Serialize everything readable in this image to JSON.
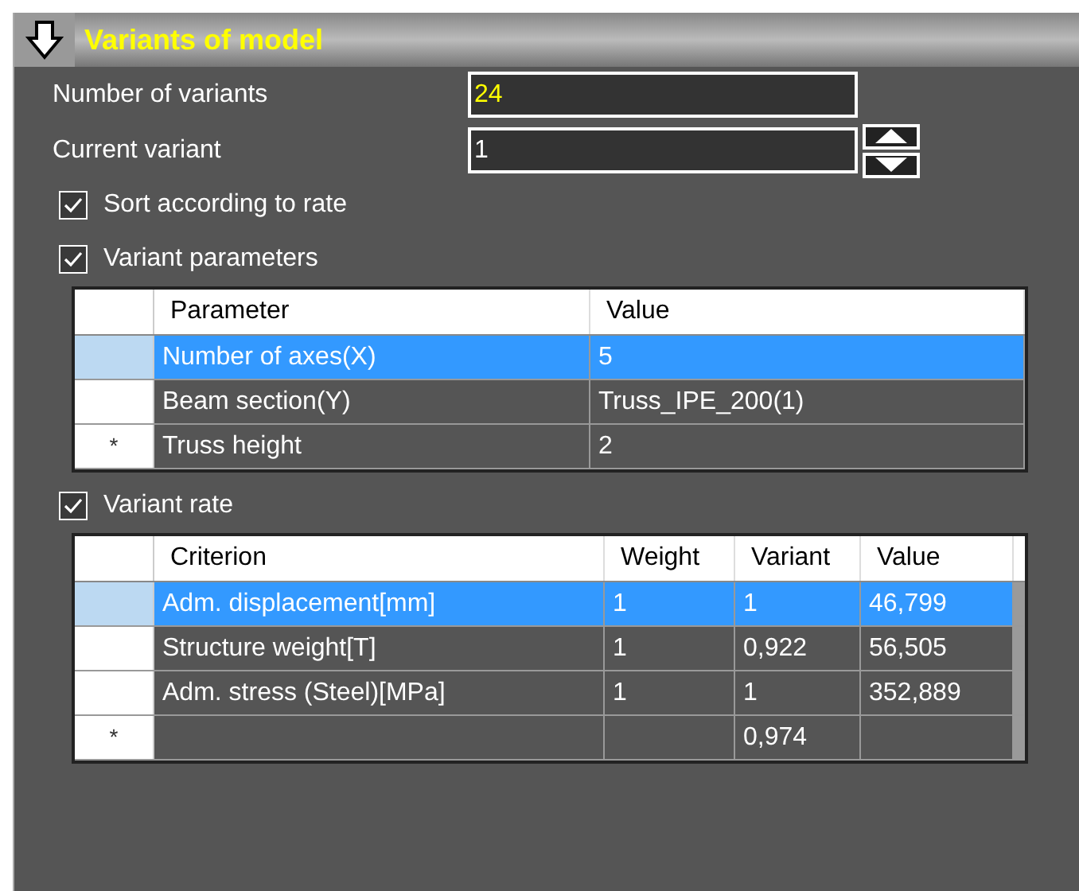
{
  "header": {
    "title": "Variants of model",
    "expanded": true
  },
  "fields": [
    {
      "label": "Number of variants",
      "value": "24",
      "kind": "readonly"
    },
    {
      "label": "Current variant",
      "value": "1",
      "kind": "spinner"
    }
  ],
  "sort_option": {
    "label": "Sort according to rate",
    "checked": true
  },
  "parameters": {
    "label": "Variant parameters",
    "checked": true,
    "columns": [
      "Parameter",
      "Value"
    ],
    "rows": [
      {
        "marker": "",
        "selected": true,
        "cells": [
          "Number of axes(X)",
          "5"
        ]
      },
      {
        "marker": "",
        "selected": false,
        "cells": [
          "Beam section(Y)",
          "Truss_IPE_200(1)"
        ]
      },
      {
        "marker": "*",
        "selected": false,
        "cells": [
          "Truss height",
          "2"
        ]
      }
    ]
  },
  "rate": {
    "label": "Variant rate",
    "checked": true,
    "columns": [
      "Criterion",
      "Weight",
      "Variant",
      "Value"
    ],
    "rows": [
      {
        "marker": "",
        "selected": true,
        "cells": [
          "Adm. displacement[mm]",
          "1",
          "1",
          "46,799"
        ]
      },
      {
        "marker": "",
        "selected": false,
        "cells": [
          "Structure weight[T]",
          "1",
          "0,922",
          "56,505"
        ]
      },
      {
        "marker": "",
        "selected": false,
        "cells": [
          "Adm. stress (Steel)[MPa]",
          "1",
          "1",
          "352,889"
        ]
      },
      {
        "marker": "*",
        "selected": false,
        "cells": [
          "",
          "",
          "0,974",
          ""
        ]
      }
    ]
  }
}
